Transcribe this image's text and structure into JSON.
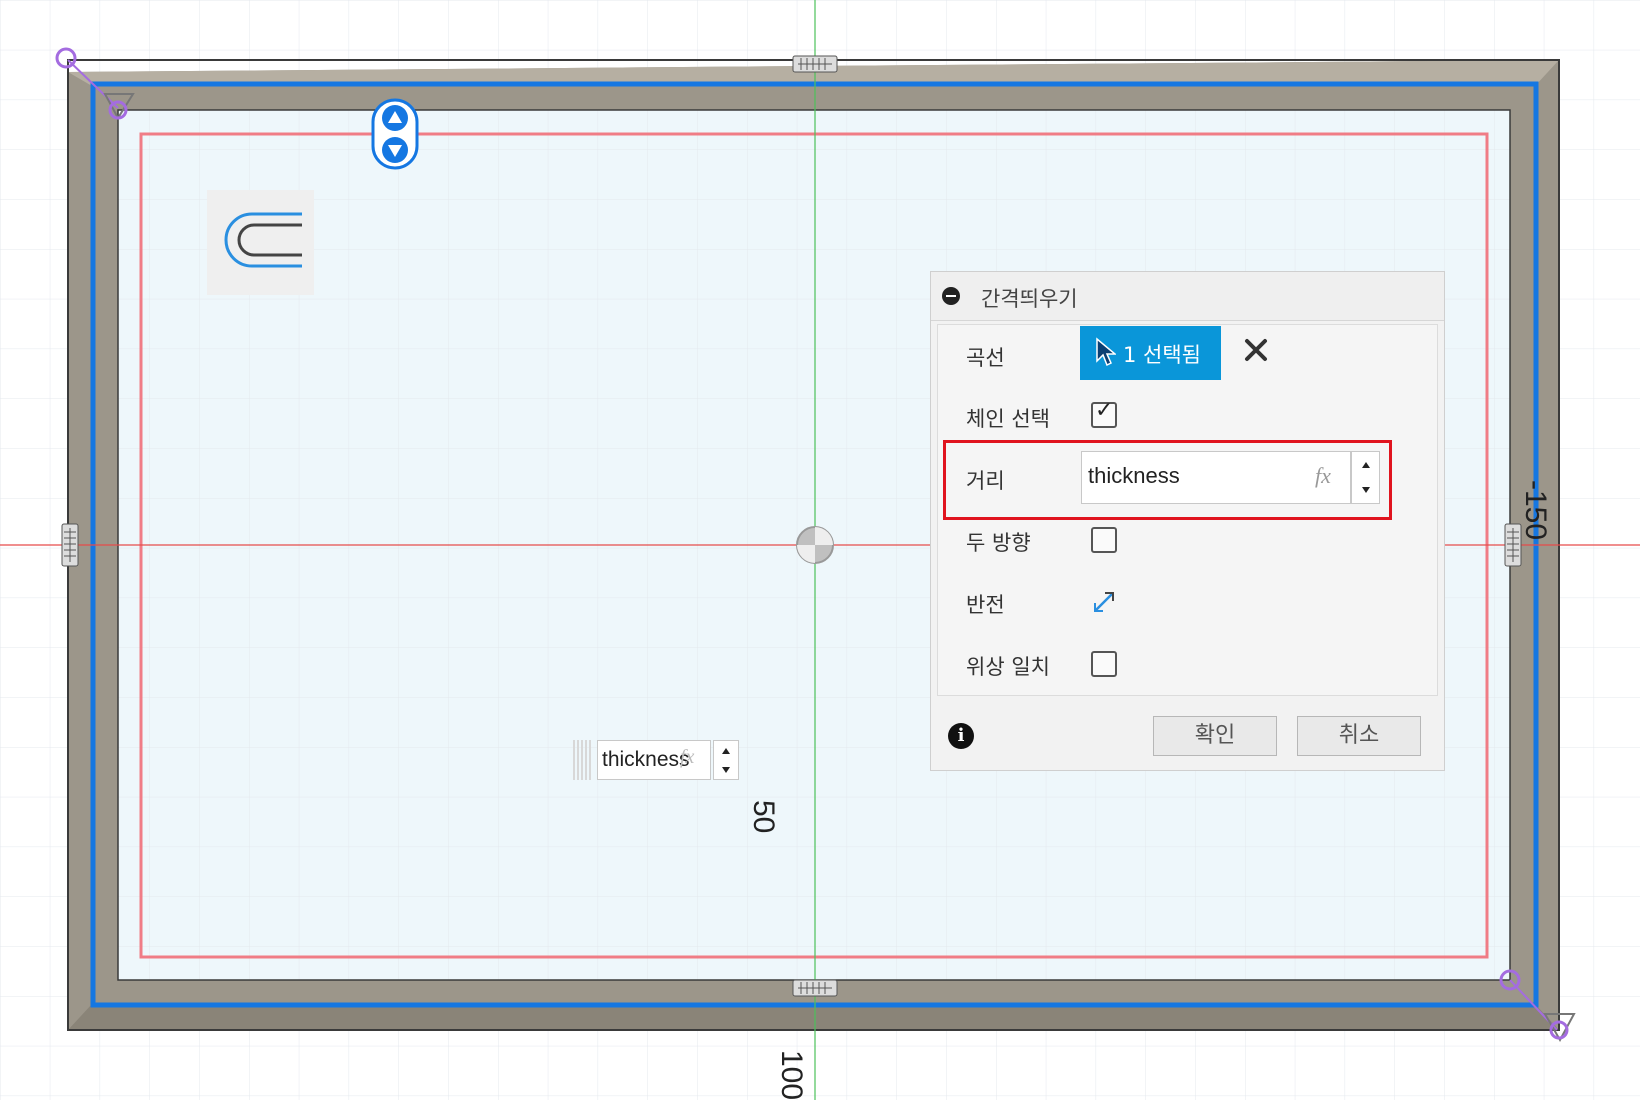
{
  "viewport": {
    "dimensions": {
      "horizontal": "-150",
      "vertical_inner": "50",
      "vertical_outer": "100"
    },
    "floating_input": {
      "value": "thickness",
      "fx_label": "fx"
    },
    "colors": {
      "grid": "#dde3ea",
      "sketch_fill": "#eef7fb",
      "wall": "#9c968a",
      "selection": "#1577e2",
      "offset_preview": "#f07c86",
      "axis_x": "#e64b4b",
      "axis_y": "#4cc15a",
      "constraint": "#a46ce0"
    }
  },
  "dialog": {
    "title": "간격띄우기",
    "rows": {
      "curve_label": "곡선",
      "select_button_label": "1 선택됨",
      "chain_label": "체인 선택",
      "chain_checked": true,
      "distance_label": "거리",
      "distance_value": "thickness",
      "fx_label": "fx",
      "both_directions_label": "두 방향",
      "both_directions_checked": false,
      "flip_label": "반전",
      "topology_label": "위상 일치",
      "topology_checked": false
    },
    "footer": {
      "ok_label": "확인",
      "cancel_label": "취소"
    },
    "icons": {
      "collapse": "collapse-icon",
      "cursor": "cursor-icon",
      "clear": "close-icon",
      "flip": "flip-icon",
      "info": "info-icon"
    }
  }
}
